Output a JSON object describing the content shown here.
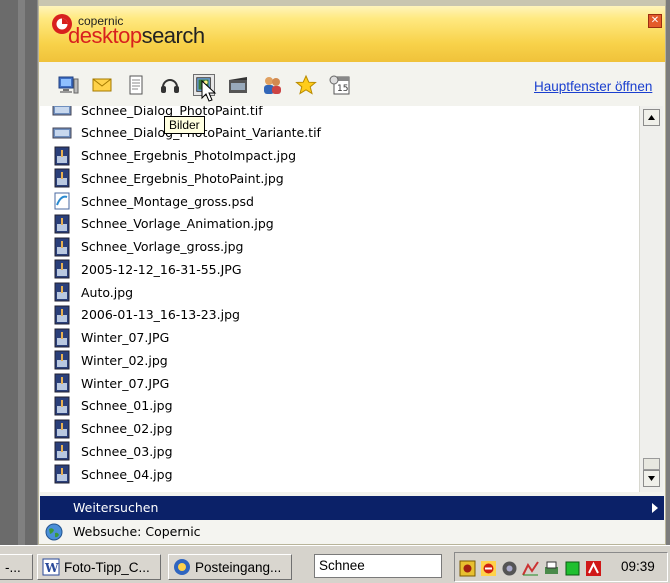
{
  "app": {
    "logo_small": "copernic",
    "logo_big_part1": "desktop",
    "logo_big_part2": "search",
    "close_glyph": "✕",
    "brand_color": "#d8201e"
  },
  "toolbar": {
    "icons": [
      "computer-icon",
      "email-icon",
      "document-icon",
      "music-icon",
      "pictures-icon",
      "video-icon",
      "contacts-icon",
      "favorites-icon",
      "history-icon"
    ],
    "selected": "pictures-icon",
    "tooltip": "Bilder",
    "open_main_window": "Hauptfenster öffnen"
  },
  "results": [
    {
      "name": "Schnee_Dialog_PhotoPaint.tif",
      "icon": "tif-image-icon"
    },
    {
      "name": "Schnee_Dialog_PhotoPaint_Variante.tif",
      "icon": "tif-image-icon"
    },
    {
      "name": "Schnee_Ergebnis_PhotoImpact.jpg",
      "icon": "jpg-image-icon"
    },
    {
      "name": "Schnee_Ergebnis_PhotoPaint.jpg",
      "icon": "jpg-image-icon"
    },
    {
      "name": "Schnee_Montage_gross.psd",
      "icon": "psd-file-icon"
    },
    {
      "name": "Schnee_Vorlage_Animation.jpg",
      "icon": "jpg-image-icon"
    },
    {
      "name": "Schnee_Vorlage_gross.jpg",
      "icon": "jpg-image-icon"
    },
    {
      "name": "2005-12-12_16-31-55.JPG",
      "icon": "jpg-image-icon"
    },
    {
      "name": "Auto.jpg",
      "icon": "jpg-image-icon"
    },
    {
      "name": "2006-01-13_16-13-23.jpg",
      "icon": "jpg-image-icon"
    },
    {
      "name": "Winter_07.JPG",
      "icon": "jpg-image-icon"
    },
    {
      "name": "Winter_02.jpg",
      "icon": "jpg-image-icon"
    },
    {
      "name": "Winter_07.JPG",
      "icon": "jpg-image-icon"
    },
    {
      "name": "Schnee_01.jpg",
      "icon": "jpg-image-icon"
    },
    {
      "name": "Schnee_02.jpg",
      "icon": "jpg-image-icon"
    },
    {
      "name": "Schnee_03.jpg",
      "icon": "jpg-image-icon"
    },
    {
      "name": "Schnee_04.jpg",
      "icon": "jpg-image-icon"
    }
  ],
  "footer": {
    "more_search": "Weitersuchen",
    "web_search": "Websuche: Copernic"
  },
  "taskbar": {
    "left_stub": "-...",
    "buttons": [
      {
        "label": "Foto-Tipp_C...",
        "icon": "word-icon"
      },
      {
        "label": "Posteingang...",
        "icon": "outlook-icon"
      }
    ],
    "search_value": "Schnee",
    "tray_icons": [
      "copernic-tray-icon",
      "antivirus-tray-icon",
      "network-tray-icon",
      "chart-tray-icon",
      "printer-tray-icon",
      "status-tray-icon",
      "avira-tray-icon"
    ],
    "clock": "09:39"
  }
}
